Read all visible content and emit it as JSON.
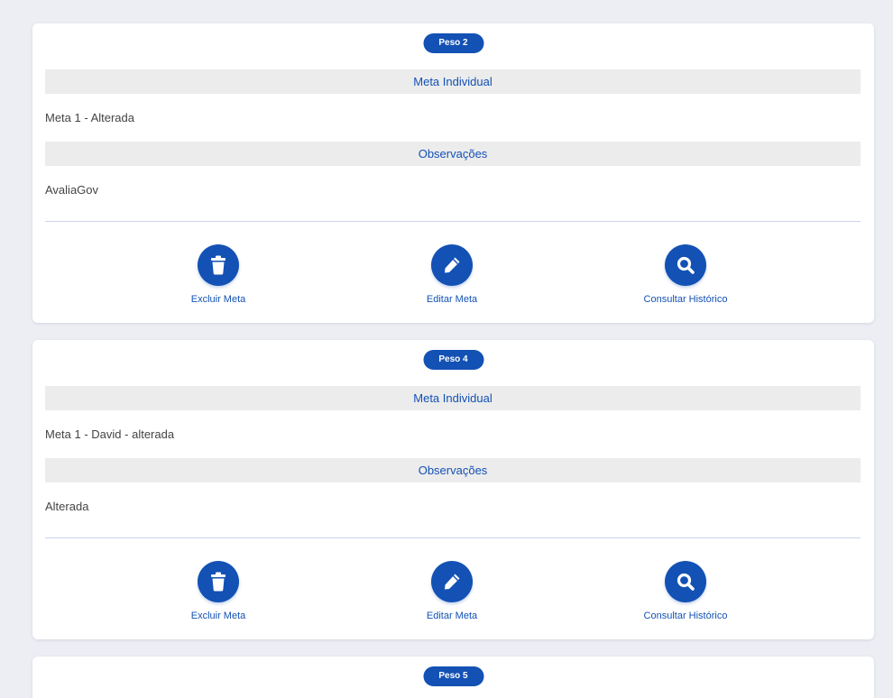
{
  "colors": {
    "primary": "#1351b4",
    "section_background": "#ececec",
    "page_background": "#eceef4"
  },
  "cards": [
    {
      "weight_badge": "Peso 2",
      "goal_header": "Meta Individual",
      "goal_value": "Meta 1 - Alterada",
      "notes_header": "Observações",
      "notes_value": "AvaliaGov",
      "actions": {
        "delete_label": "Excluir Meta",
        "edit_label": "Editar Meta",
        "history_label": "Consultar Histórico"
      }
    },
    {
      "weight_badge": "Peso 4",
      "goal_header": "Meta Individual",
      "goal_value": "Meta 1 - David - alterada",
      "notes_header": "Observações",
      "notes_value": "Alterada",
      "actions": {
        "delete_label": "Excluir Meta",
        "edit_label": "Editar Meta",
        "history_label": "Consultar Histórico"
      }
    },
    {
      "weight_badge": "Peso 5"
    }
  ],
  "icons": {
    "delete": "trash-icon",
    "edit": "pencil-icon",
    "history": "search-icon"
  }
}
